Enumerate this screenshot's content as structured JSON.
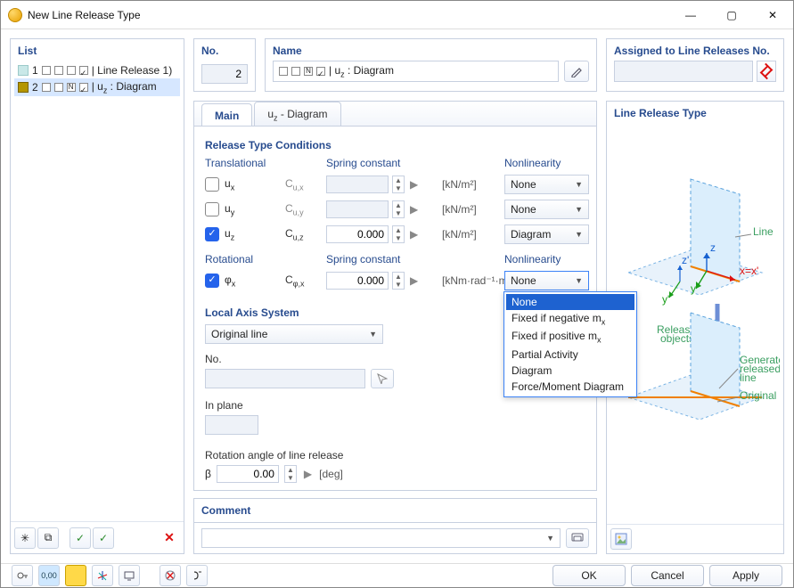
{
  "window": {
    "title": "New Line Release Type"
  },
  "list": {
    "header": "List",
    "items": [
      {
        "num": "1",
        "label": "| Line Release 1)",
        "checks": [
          "off",
          "off",
          "off",
          "on"
        ],
        "swatch": "y"
      },
      {
        "num": "2",
        "label": "| u_z : Diagram",
        "checks": [
          "off",
          "off",
          "N",
          "on"
        ],
        "swatch": "o"
      }
    ]
  },
  "no": {
    "header": "No.",
    "value": "2"
  },
  "name": {
    "header": "Name",
    "checks": [
      "off",
      "off",
      "N",
      "on"
    ],
    "value": "| u_z : Diagram"
  },
  "assigned": {
    "header": "Assigned to Line Releases No."
  },
  "tabs": {
    "main": "Main",
    "uz": "u_z - Diagram"
  },
  "sections": {
    "release_type": "Release Type Conditions",
    "translational": "Translational",
    "spring": "Spring constant",
    "nonlinearity": "Nonlinearity",
    "rotational": "Rotational",
    "local_axis": "Local Axis System",
    "no_sub": "No.",
    "in_plane": "In plane",
    "rotation_angle": "Rotation angle of line release",
    "comment": "Comment",
    "lr_type": "Line Release Type"
  },
  "rows": {
    "ux": {
      "sym": "u_x",
      "clabel": "C_u,x",
      "val": "",
      "unit": "[kN/m²]",
      "nl": "None",
      "checked": false,
      "enabled": false
    },
    "uy": {
      "sym": "u_y",
      "clabel": "C_u,y",
      "val": "",
      "unit": "[kN/m²]",
      "nl": "None",
      "checked": false,
      "enabled": false
    },
    "uz": {
      "sym": "u_z",
      "clabel": "C_u,z",
      "val": "0.000",
      "unit": "[kN/m²]",
      "nl": "Diagram",
      "checked": true,
      "enabled": true
    },
    "phix": {
      "sym": "φ_x",
      "clabel": "C_φ,x",
      "val": "0.000",
      "unit": "[kNm·rad⁻¹·m⁻¹]",
      "nl": "None",
      "checked": true,
      "enabled": true
    }
  },
  "local_axis": {
    "value": "Original line"
  },
  "rotation": {
    "sym": "β",
    "val": "0.00",
    "unit": "[deg]"
  },
  "nonlin_opts": [
    "None",
    "Fixed if negative m_x",
    "Fixed if positive m_x",
    "Partial Activity",
    "Diagram",
    "Force/Moment Diagram"
  ],
  "diagram_labels": {
    "line": "Line",
    "released": "Released objects",
    "generated": "Generated released line",
    "original": "Original line"
  },
  "buttons": {
    "ok": "OK",
    "cancel": "Cancel",
    "apply": "Apply"
  }
}
